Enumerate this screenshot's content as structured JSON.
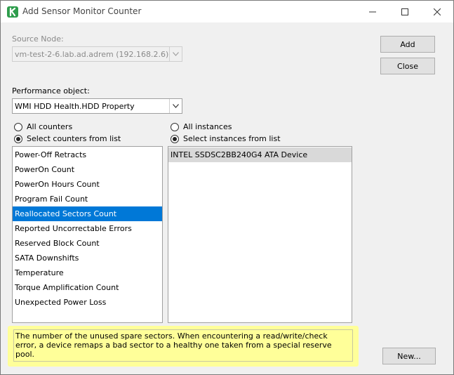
{
  "window": {
    "title": "Add Sensor Monitor Counter",
    "controls": [
      "minimize-icon",
      "maximize-icon",
      "close-icon"
    ]
  },
  "source_node": {
    "label": "Source Node:",
    "value": "vm-test-2-6.lab.ad.adrem (192.168.2.6)",
    "enabled": false
  },
  "performance_object": {
    "label": "Performance object:",
    "value": "WMI HDD Health.HDD Property"
  },
  "buttons": {
    "add": "Add",
    "close": "Close",
    "new": "New..."
  },
  "counters": {
    "all_label": "All counters",
    "select_label": "Select counters from list",
    "selected_mode": "select",
    "items": [
      "Power-Off Retracts",
      "PowerOn Count",
      "PowerOn Hours Count",
      "Program Fail Count",
      "Reallocated Sectors Count",
      "Reported Uncorrectable Errors",
      "Reserved Block Count",
      "SATA Downshifts",
      "Temperature",
      "Torque Amplification Count",
      "Unexpected Power Loss"
    ],
    "selected_item": "Reallocated Sectors Count"
  },
  "instances": {
    "all_label": "All instances",
    "select_label": "Select instances from list",
    "selected_mode": "select",
    "items": [
      "INTEL SSDSC2BB240G4 ATA Device"
    ],
    "selected_item": "INTEL SSDSC2BB240G4 ATA Device"
  },
  "description": "The number of the unused spare sectors. When encountering a read/write/check error, a device remaps a bad sector to a healthy one taken from a special reserve pool.",
  "colors": {
    "selection": "#0078d7",
    "description_bg": "#ffff99",
    "app_icon": "#2e9d4c"
  }
}
